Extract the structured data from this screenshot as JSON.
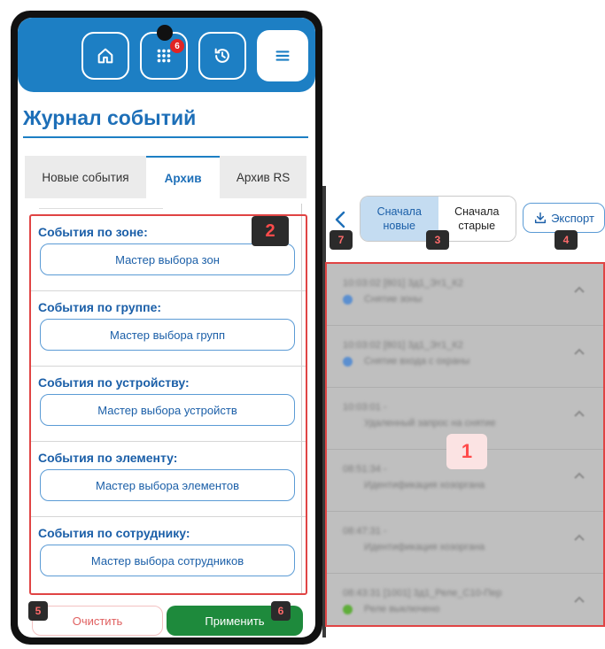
{
  "topbar": {
    "badge": "6",
    "icons": [
      "home-icon",
      "grid-icon",
      "history-icon",
      "menu-icon"
    ]
  },
  "page": {
    "title": "Журнал событий"
  },
  "tabs": [
    {
      "label": "Новые события",
      "active": false
    },
    {
      "label": "Архив",
      "active": true
    },
    {
      "label": "Архив RS",
      "active": false
    }
  ],
  "filters": [
    {
      "title": "События по зоне:",
      "button": "Мастер выбора зон"
    },
    {
      "title": "События по группе:",
      "button": "Мастер выбора групп"
    },
    {
      "title": "События по устройству:",
      "button": "Мастер выбора устройств"
    },
    {
      "title": "События по элементу:",
      "button": "Мастер выбора элементов"
    },
    {
      "title": "События по сотруднику:",
      "button": "Мастер выбора сотрудников"
    }
  ],
  "actions": {
    "clear": "Очистить",
    "apply": "Применить"
  },
  "toolbar": {
    "sort_new": "Сначала\nновые",
    "sort_old": "Сначала\nстарые",
    "export": "Экспорт"
  },
  "events": [
    {
      "line1": "10:03:02 [801] 3д1_Эт1_К2",
      "line2": "Снятие зоны",
      "dot": "#5b8fd0"
    },
    {
      "line1": "10:03:02 [801] 3д1_Эт1_К2",
      "line2": "Снятие входа с охраны",
      "dot": "#5b8fd0"
    },
    {
      "line1": "10:03:01 -",
      "line2": "Удаленный запрос на снятие",
      "dot": ""
    },
    {
      "line1": "08:51:34 -",
      "line2": "Идентификация хозоргана",
      "dot": ""
    },
    {
      "line1": "08:47:31 -",
      "line2": "Идентификация хозоргана",
      "dot": ""
    },
    {
      "line1": "08:43:31 [1001] 3д1_Реле_С10-Пер",
      "line2": "Реле выключено",
      "dot": "#5fae3a"
    }
  ],
  "markers": {
    "m1": "1",
    "m2": "2",
    "m3": "3",
    "m4": "4",
    "m5": "5",
    "m6": "6",
    "m7": "7"
  },
  "colors": {
    "brand": "#1d7fc4",
    "apply": "#1e8a3c",
    "highlight": "#e04444"
  }
}
